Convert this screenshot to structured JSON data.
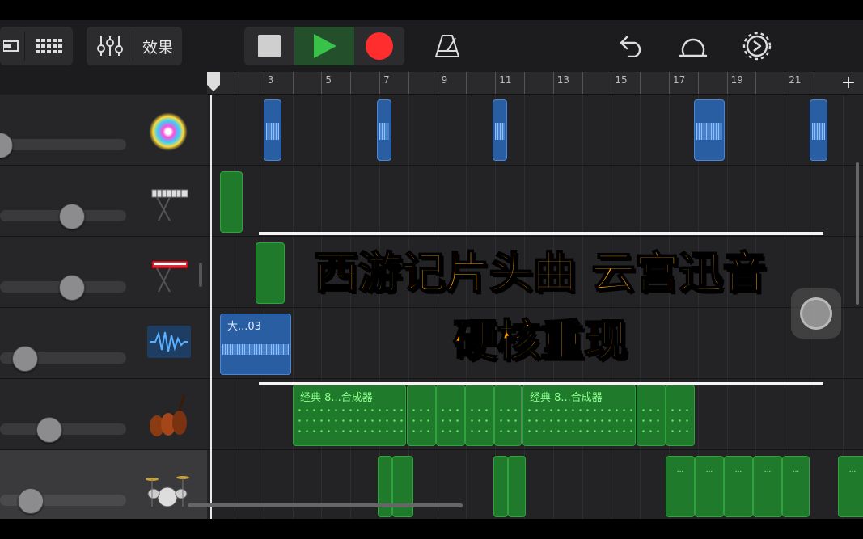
{
  "toolbar": {
    "effects_label": "效果",
    "icons": [
      "tracks-view-icon",
      "grid-icon",
      "mixer-icon",
      "stop-icon",
      "play-icon",
      "record-icon",
      "metronome-icon",
      "undo-icon",
      "loop-icon",
      "settings-icon"
    ]
  },
  "ruler": {
    "labels": [
      "3",
      "5",
      "7",
      "9",
      "11",
      "13",
      "15",
      "17",
      "19",
      "21"
    ],
    "add_label": "+"
  },
  "tracks": [
    {
      "name": "sparkle-instrument",
      "icon": "sparkle-icon",
      "volume": 0.0
    },
    {
      "name": "keyboard",
      "icon": "keyboard-icon",
      "volume": 0.57
    },
    {
      "name": "red-keyboard",
      "icon": "red-keyboard-icon",
      "volume": 0.57
    },
    {
      "name": "audio-recorder",
      "icon": "waveform-icon",
      "volume": 0.19
    },
    {
      "name": "strings",
      "icon": "violin-icon",
      "volume": 0.38
    },
    {
      "name": "drums",
      "icon": "drums-icon",
      "volume": 0.24
    }
  ],
  "regions": {
    "audio_label": "大...03",
    "synth_label_1": "经典 8...合成器",
    "synth_label_2": "经典 8...合成器",
    "drum_dots": "..."
  },
  "overlay": {
    "title_line1": "西游记片头曲 云宫迅音",
    "title_line2": "硬核重现"
  },
  "colors": {
    "play_green": "#38c24a",
    "record_red": "#ff2d2d",
    "title_orange": "#ffa000",
    "region_blue": "#2a5ea3",
    "region_green": "#1f7a2c"
  }
}
